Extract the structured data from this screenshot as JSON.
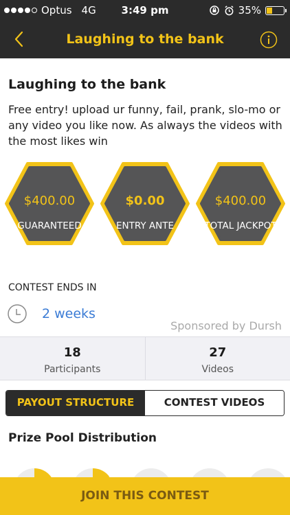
{
  "status_bar": {
    "carrier": "Optus",
    "network": "4G",
    "time": "3:49 pm",
    "battery": "35%",
    "battery_level": 0.35
  },
  "nav": {
    "title": "Laughing to the bank",
    "back_icon": "chevron-left-icon",
    "info_icon": "info-icon"
  },
  "contest": {
    "title": "Laughing to the bank",
    "description": "Free entry! upload ur funny, fail, prank, slo-mo or any video you like now. As always the videos with the most likes win"
  },
  "prizes": [
    {
      "amount": "$400.00",
      "label": "GUARANTEED"
    },
    {
      "amount": "$0.00",
      "label": "ENTRY ANTE"
    },
    {
      "amount": "$400.00",
      "label": "TOTAL JACKPOT"
    }
  ],
  "ends": {
    "label": "CONTEST ENDS IN",
    "value": "2 weeks"
  },
  "sponsored": "Sponsored by Dursh",
  "stats": {
    "participants_count": "18",
    "participants_label": "Participants",
    "videos_count": "27",
    "videos_label": "Videos"
  },
  "tabs": {
    "payout": "PAYOUT STRUCTURE",
    "videos": "CONTEST VIDEOS"
  },
  "section_title": "Prize Pool Distribution",
  "join_button": "JOIN THIS CONTEST",
  "colors": {
    "accent": "#f2c318",
    "dark": "#2b2b2b",
    "link": "#3a7bd5"
  }
}
